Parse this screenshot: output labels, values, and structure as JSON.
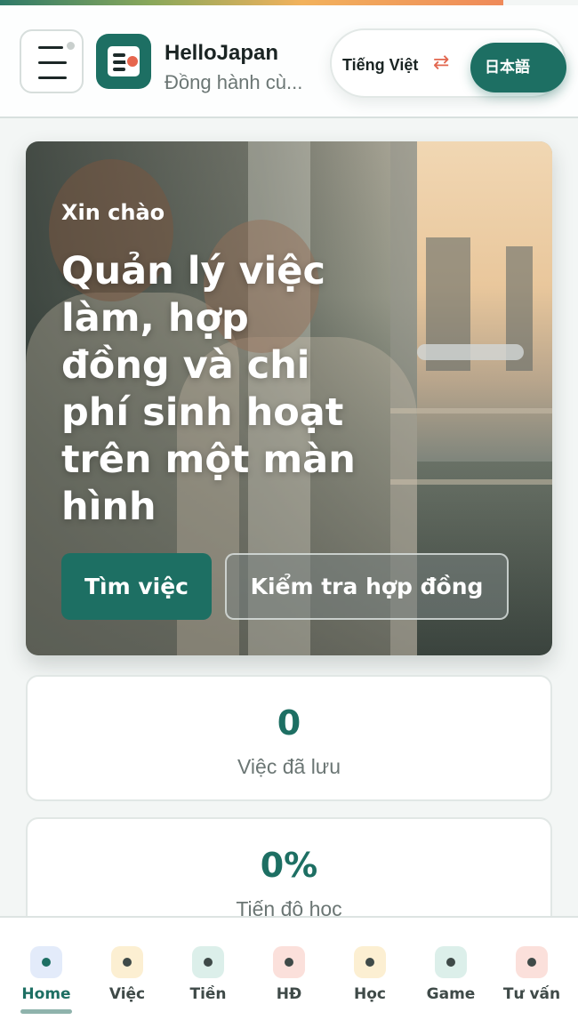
{
  "header": {
    "app_title": "HelloJapan",
    "app_subtitle": "Đồng hành cù...",
    "lang_current": "Tiếng Việt",
    "lang_swap_icon": "⇄",
    "lang_target": "日本語"
  },
  "hero": {
    "greeting": "Xin chào",
    "title": "Quản lý việc làm, hợp đồng và chi phí sinh hoạt trên một màn hình",
    "primary_button": "Tìm việc",
    "secondary_button": "Kiểm tra hợp đồng"
  },
  "stats": [
    {
      "value": "0",
      "label": "Việc đã lưu"
    },
    {
      "value": "0%",
      "label": "Tiến độ học"
    }
  ],
  "nav": {
    "items": [
      {
        "label": "Home",
        "icon": "home-icon",
        "color": "#e3ebfa",
        "active": true
      },
      {
        "label": "Việc",
        "icon": "jobs-icon",
        "color": "#fcefd2",
        "active": false
      },
      {
        "label": "Tiền",
        "icon": "money-icon",
        "color": "#dcefea",
        "active": false
      },
      {
        "label": "HĐ",
        "icon": "contract-icon",
        "color": "#fbe0db",
        "active": false
      },
      {
        "label": "Học",
        "icon": "study-icon",
        "color": "#fcefd2",
        "active": false
      },
      {
        "label": "Game",
        "icon": "game-icon",
        "color": "#dcefea",
        "active": false
      },
      {
        "label": "Tư vấn",
        "icon": "consult-icon",
        "color": "#fbe0db",
        "active": false
      }
    ]
  },
  "colors": {
    "brand": "#1d6f63",
    "accent": "#e2674f"
  }
}
